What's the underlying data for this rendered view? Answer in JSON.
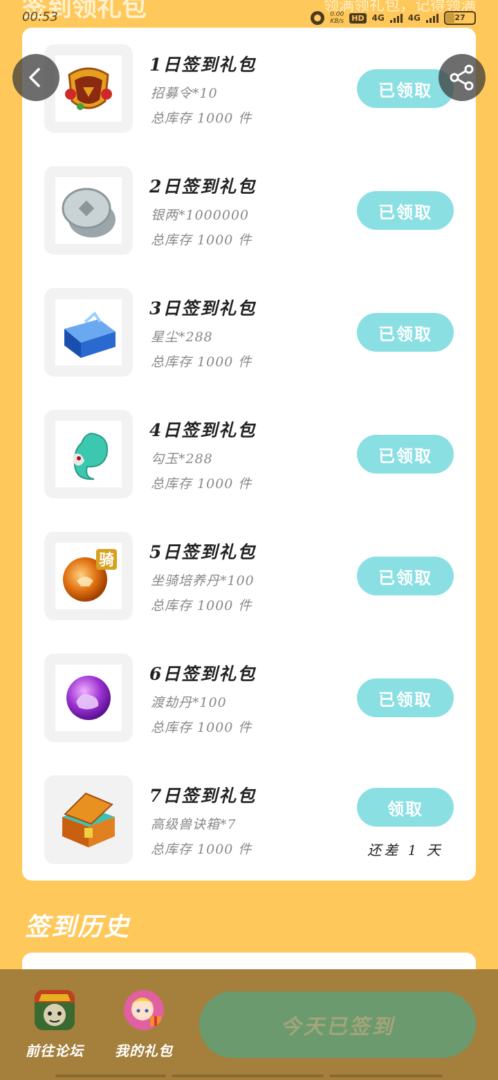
{
  "status_bar": {
    "time": "00:53",
    "faded_title": "签到领礼包",
    "faded_subtitle": "领满领礼包，记得领满",
    "net_speed": "0.00",
    "net_speed_unit": "KB/s",
    "hd_label": "HD",
    "net1": "4G",
    "net2": "4G",
    "battery": "27"
  },
  "gifts": [
    {
      "title": "1日签到礼包",
      "content": "招募令*10",
      "stock": "总库存 1000 件",
      "button": "已领取",
      "icon": "recruit-token-icon"
    },
    {
      "title": "2日签到礼包",
      "content": "银两*1000000",
      "stock": "总库存 1000 件",
      "button": "已领取",
      "icon": "silver-coin-icon"
    },
    {
      "title": "3日签到礼包",
      "content": "星尘*288",
      "stock": "总库存 1000 件",
      "button": "已领取",
      "icon": "stardust-chest-icon"
    },
    {
      "title": "4日签到礼包",
      "content": "勾玉*288",
      "stock": "总库存 1000 件",
      "button": "已领取",
      "icon": "magatama-icon"
    },
    {
      "title": "5日签到礼包",
      "content": "坐骑培养丹*100",
      "stock": "总库存 1000 件",
      "button": "已领取",
      "icon": "mount-pill-icon"
    },
    {
      "title": "6日签到礼包",
      "content": "渡劫丹*100",
      "stock": "总库存 1000 件",
      "button": "已领取",
      "icon": "tribulation-pill-icon"
    },
    {
      "title": "7日签到礼包",
      "content": "高级兽诀箱*7",
      "stock": "总库存 1000 件",
      "button": "领取",
      "remaining": "还差 1 天",
      "icon": "treasure-chest-icon"
    }
  ],
  "badge_char": "骑",
  "history": {
    "title": "签到历史"
  },
  "bottom_nav": {
    "forum_label": "前往论坛",
    "my_gifts_label": "我的礼包",
    "signin_button": "今天已签到"
  },
  "colors": {
    "background": "#FFC85A",
    "claim_button": "#8ADFE3",
    "bottom_bar": "#A4803C",
    "signin_button": "#6A9A6E"
  }
}
